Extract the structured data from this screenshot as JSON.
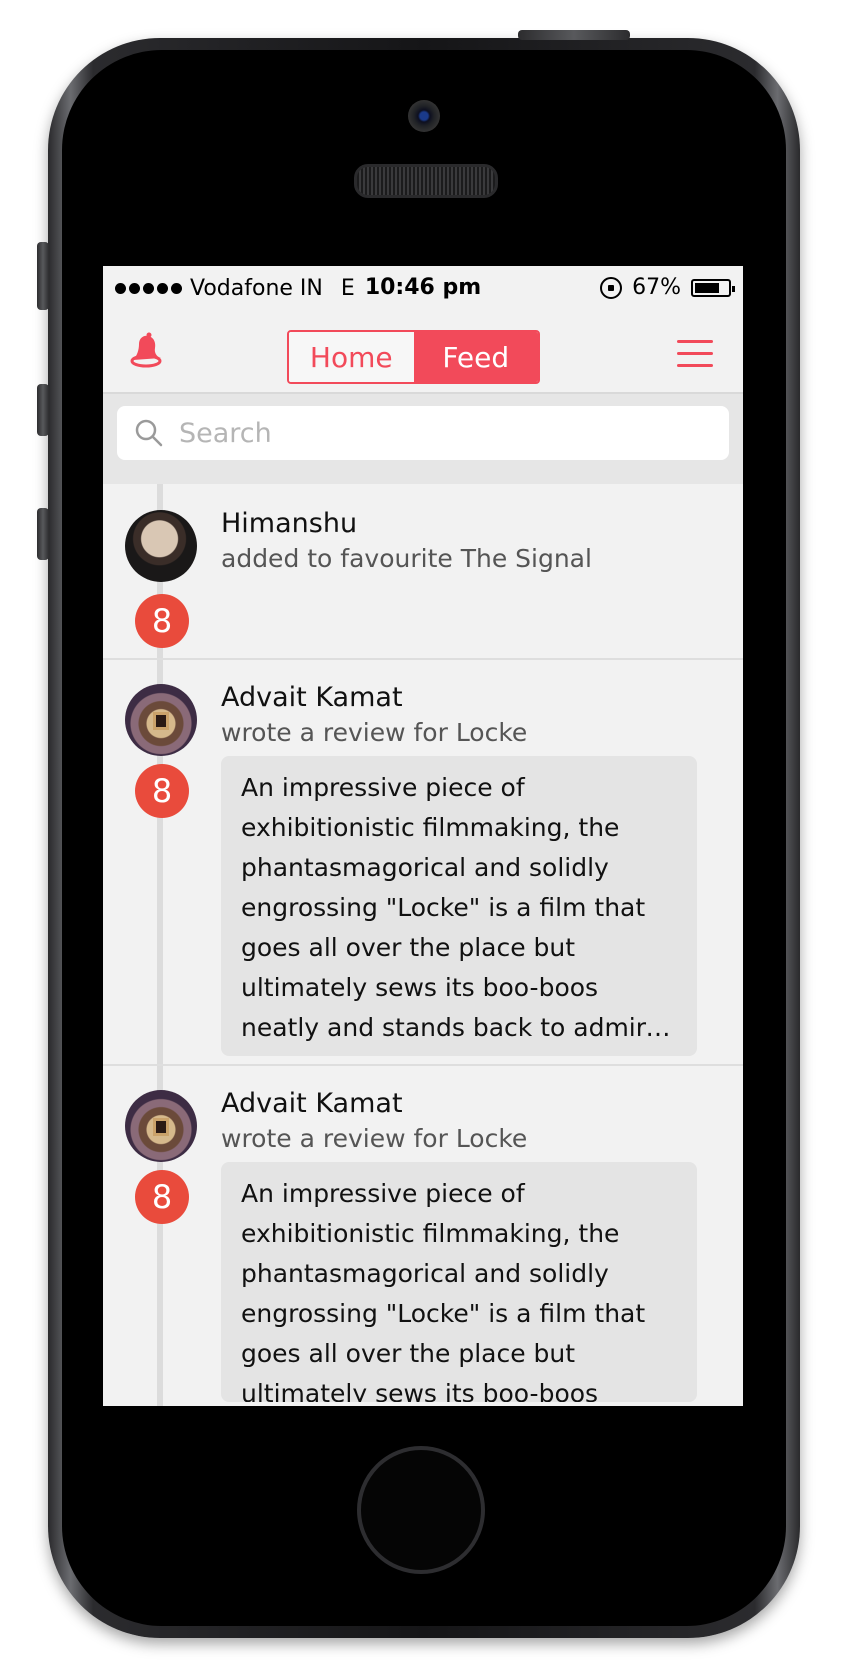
{
  "status_bar": {
    "carrier": "Vodafone IN",
    "network": "E",
    "time": "10:46 pm",
    "battery": "67%"
  },
  "nav": {
    "tabs": [
      "Home",
      "Feed"
    ],
    "active_tab": "Feed",
    "accent_color": "#f24a5a"
  },
  "search": {
    "placeholder": "Search",
    "value": ""
  },
  "feed": {
    "items": [
      {
        "name": "Himanshu",
        "action": "added to favourite The Signal",
        "score": "8"
      },
      {
        "name": "Advait Kamat",
        "action": "wrote a review for Locke",
        "score": "8",
        "review": "An impressive piece of exhibitionistic filmmaking, the phantasmagorical and solidly engrossing \"Locke\" is a film that goes all over the place but ultimately sews its boo-boos neatly and stands back to admire the majestic effect. What elevates it above the other great films"
      },
      {
        "name": "Advait Kamat",
        "action": "wrote a review for Locke",
        "score": "8",
        "review": "An impressive piece of exhibitionistic filmmaking, the phantasmagorical and solidly engrossing \"Locke\" is a film that goes all over the place but ultimately sews its boo-boos neatly and stands back to admire the majestic effect."
      }
    ]
  },
  "icons": {
    "bell": "bell-icon",
    "menu": "hamburger-menu-icon",
    "search": "search-icon",
    "badge_color": "#e94b3c"
  }
}
